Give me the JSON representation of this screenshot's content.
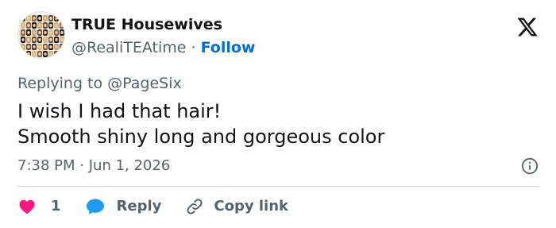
{
  "author": {
    "display_name": "TRUE Housewives",
    "handle": "@RealiTEAtime",
    "separator": "·",
    "follow_label": "Follow"
  },
  "reply": {
    "prefix": "Replying to",
    "target": "@PageSix"
  },
  "tweet": {
    "lines": [
      "I wish I had that hair!",
      "Smooth shiny long and gorgeous color"
    ]
  },
  "meta": {
    "time": "7:38 PM",
    "separator": "·",
    "date": "Jun 1, 2026"
  },
  "actions": {
    "like_count": "1",
    "reply_label": "Reply",
    "copy_label": "Copy link"
  },
  "icons": {
    "brand": "x-logo-icon",
    "info": "info-icon",
    "like": "heart-icon",
    "reply": "speech-bubble-icon",
    "copy": "link-icon"
  },
  "colors": {
    "link_blue": "#006fd6",
    "heart": "#f91880",
    "reply_bubble": "#1d9bf0",
    "secondary_text": "#536471",
    "divider": "#cfd9de"
  }
}
